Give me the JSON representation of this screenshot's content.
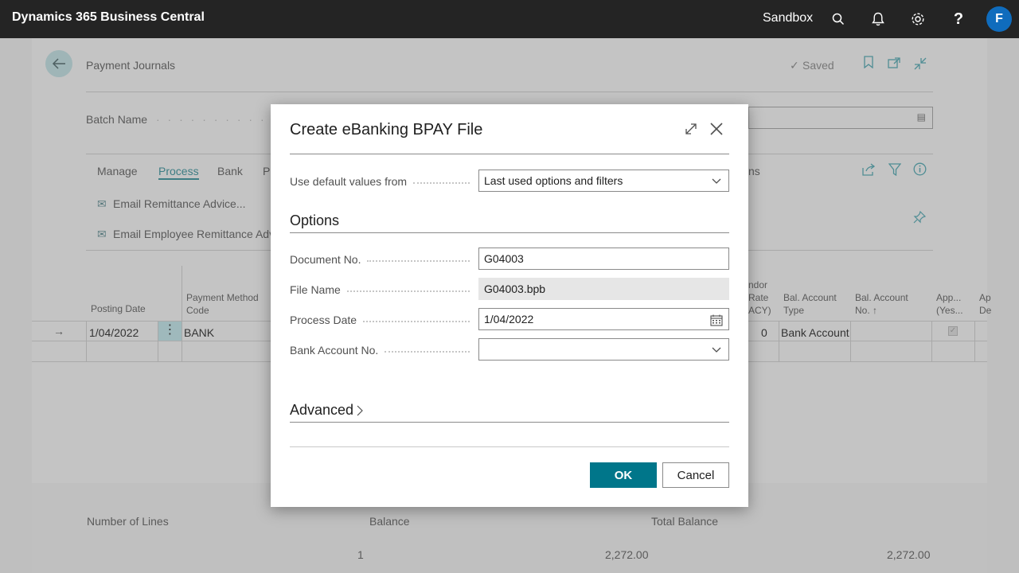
{
  "topbar": {
    "app_title": "Dynamics 365 Business Central",
    "environment": "Sandbox",
    "avatar_initial": "F"
  },
  "page": {
    "title": "Payment Journals",
    "saved_label": "Saved",
    "batch_label": "Batch Name",
    "tabs": [
      "Manage",
      "Process",
      "Bank",
      "Pr"
    ],
    "tabs_right_fragment": "ns",
    "actions": [
      "Email Remittance Advice...",
      "Email Employee Remittance Adv"
    ],
    "columns": {
      "posting_date": "Posting Date",
      "payment_method_1": "Payment Method",
      "payment_method_2": "Code",
      "vendor_1": "ndor",
      "vendor_2": "Rate",
      "vendor_3": "ACY)",
      "bal_type_1": "Bal. Account",
      "bal_type_2": "Type",
      "bal_no_1": "Bal. Account",
      "bal_no_2": "No. ↑",
      "app_1": "App...",
      "app_2": "(Yes...",
      "ap_1": "Ap",
      "ap_2": "De"
    },
    "row": {
      "posting_date": "1/04/2022",
      "payment_method": "BANK",
      "vendor_value": "0",
      "bal_account_type": "Bank Account"
    },
    "footer": {
      "number_of_lines_label": "Number of Lines",
      "balance_label": "Balance",
      "total_balance_label": "Total Balance",
      "number_of_lines": "1",
      "balance": "2,272.00",
      "total_balance": "2,272.00"
    }
  },
  "dialog": {
    "title": "Create eBanking BPAY File",
    "defaults_label": "Use default values from",
    "defaults_value": "Last used options and filters",
    "options_title": "Options",
    "fields": [
      {
        "label": "Document No.",
        "value": "G04003"
      },
      {
        "label": "File Name",
        "value": "G04003.bpb"
      },
      {
        "label": "Process Date",
        "value": "1/04/2022"
      },
      {
        "label": "Bank Account No.",
        "value": ""
      }
    ],
    "advanced_title": "Advanced",
    "ok_label": "OK",
    "cancel_label": "Cancel"
  },
  "colors": {
    "accent": "#00768a",
    "topbar": "#242424",
    "avatar": "#0f6cbd"
  }
}
